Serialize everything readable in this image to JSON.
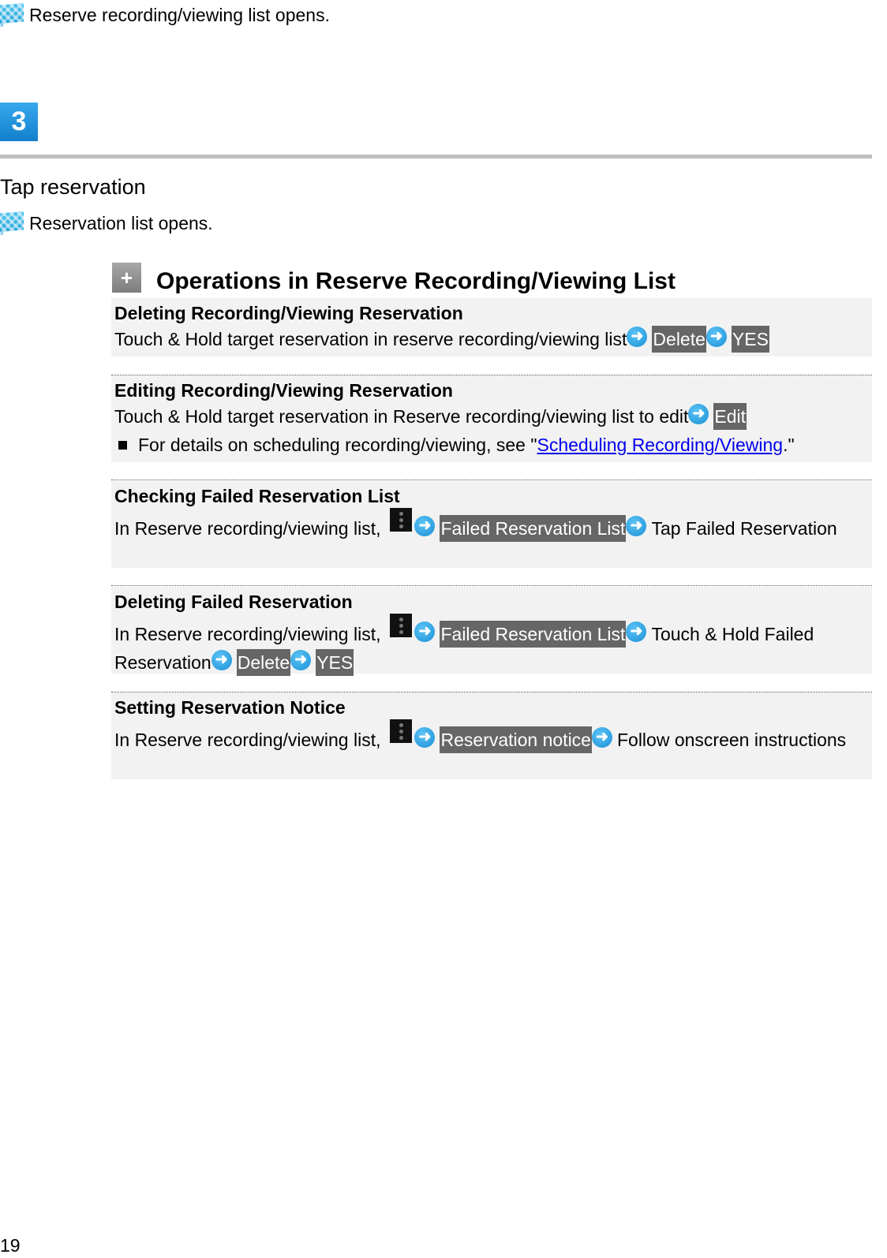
{
  "top_result": {
    "icon": "flag-icon",
    "text": "Reserve recording/viewing list opens."
  },
  "step": {
    "number": "3",
    "instruction": "Tap reservation",
    "result": {
      "icon": "flag-icon",
      "text": "Reservation list opens."
    }
  },
  "section": {
    "icon": "plus-icon",
    "title": "Operations in Reserve Recording/Viewing List",
    "items": [
      {
        "title": "Deleting Recording/Viewing Reservation",
        "text1": "Touch & Hold target reservation in reserve recording/viewing list",
        "key1": "Delete",
        "key2": "YES"
      },
      {
        "title": "Editing Recording/Viewing Reservation",
        "text1": "Touch & Hold target reservation in Reserve recording/viewing list to edit",
        "key1": "Edit",
        "note_prefix": "For details on scheduling recording/viewing, see \"",
        "note_link": "Scheduling Recording/Viewing",
        "note_suffix": ".\""
      },
      {
        "title": "Checking Failed Reservation List",
        "text1": "In Reserve recording/viewing list,",
        "menu_icon": "menu-icon",
        "key1": "Failed Reservation List",
        "text2": "Tap Failed Reservation"
      },
      {
        "title": "Deleting Failed Reservation",
        "text1": "In Reserve recording/viewing list,",
        "menu_icon": "menu-icon",
        "key1": "Failed Reservation List",
        "text2": "Touch & Hold Failed Reservation",
        "key2": "Delete",
        "key3": "YES"
      },
      {
        "title": "Setting Reservation Notice",
        "text1": "In Reserve recording/viewing list,",
        "menu_icon": "menu-icon",
        "key1": "Reservation notice",
        "text2": "Follow onscreen instructions"
      }
    ]
  },
  "colors": {
    "step_badge": "#1e8fdb",
    "key_bg": "#666666",
    "block_bg": "#f2f2f2",
    "link": "#0000ee"
  },
  "page_number": "19"
}
